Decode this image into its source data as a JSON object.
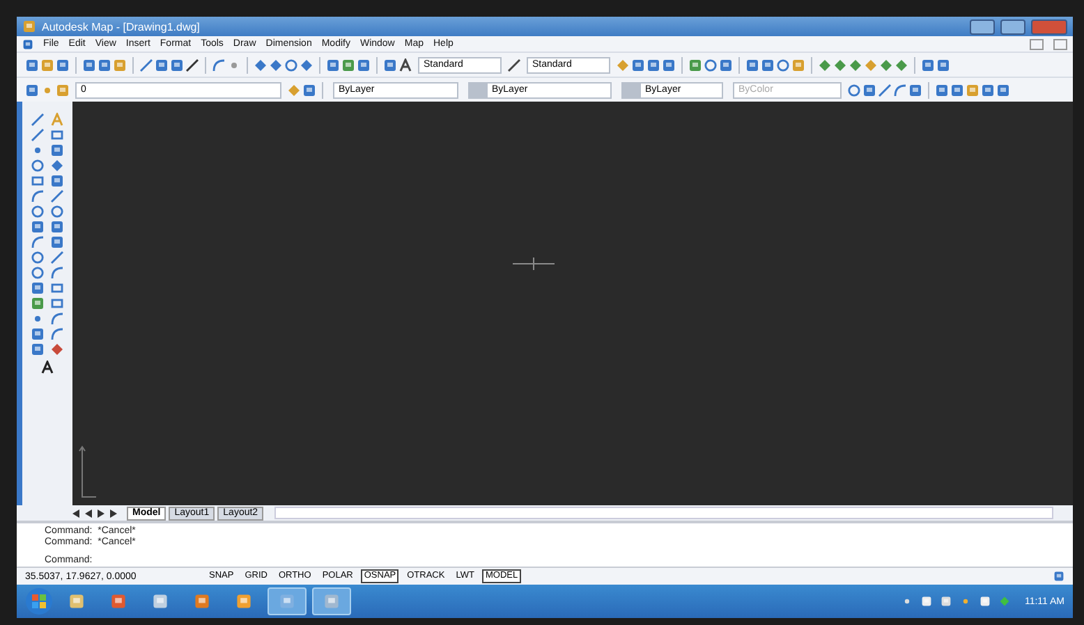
{
  "window": {
    "title": "Autodesk Map - [Drawing1.dwg]"
  },
  "menu": [
    "File",
    "Edit",
    "View",
    "Insert",
    "Format",
    "Tools",
    "Draw",
    "Dimension",
    "Modify",
    "Window",
    "Map",
    "Help"
  ],
  "toolbar": {
    "text_style": "Standard",
    "dim_style": "Standard"
  },
  "properties_bar": {
    "layer": "0",
    "color_control": "ByLayer",
    "linetype": "ByLayer",
    "lineweight": "ByLayer",
    "plot_style": "ByColor",
    "plot_style_disabled": true
  },
  "layout_tabs": [
    {
      "label": "Model",
      "selected": true
    },
    {
      "label": "Layout1",
      "selected": false
    },
    {
      "label": "Layout2",
      "selected": false
    }
  ],
  "command_history": [
    "Command:  *Cancel*",
    "Command:  *Cancel*"
  ],
  "command_prompt": "Command:",
  "coordinates": "35.5037, 17.9627, 0.0000",
  "status_toggles": [
    {
      "label": "SNAP",
      "on": false
    },
    {
      "label": "GRID",
      "on": false
    },
    {
      "label": "ORTHO",
      "on": false
    },
    {
      "label": "POLAR",
      "on": false
    },
    {
      "label": "OSNAP",
      "on": true
    },
    {
      "label": "OTRACK",
      "on": false
    },
    {
      "label": "LWT",
      "on": false
    },
    {
      "label": "MODEL",
      "on": true
    }
  ],
  "clock": "11:11 AM"
}
